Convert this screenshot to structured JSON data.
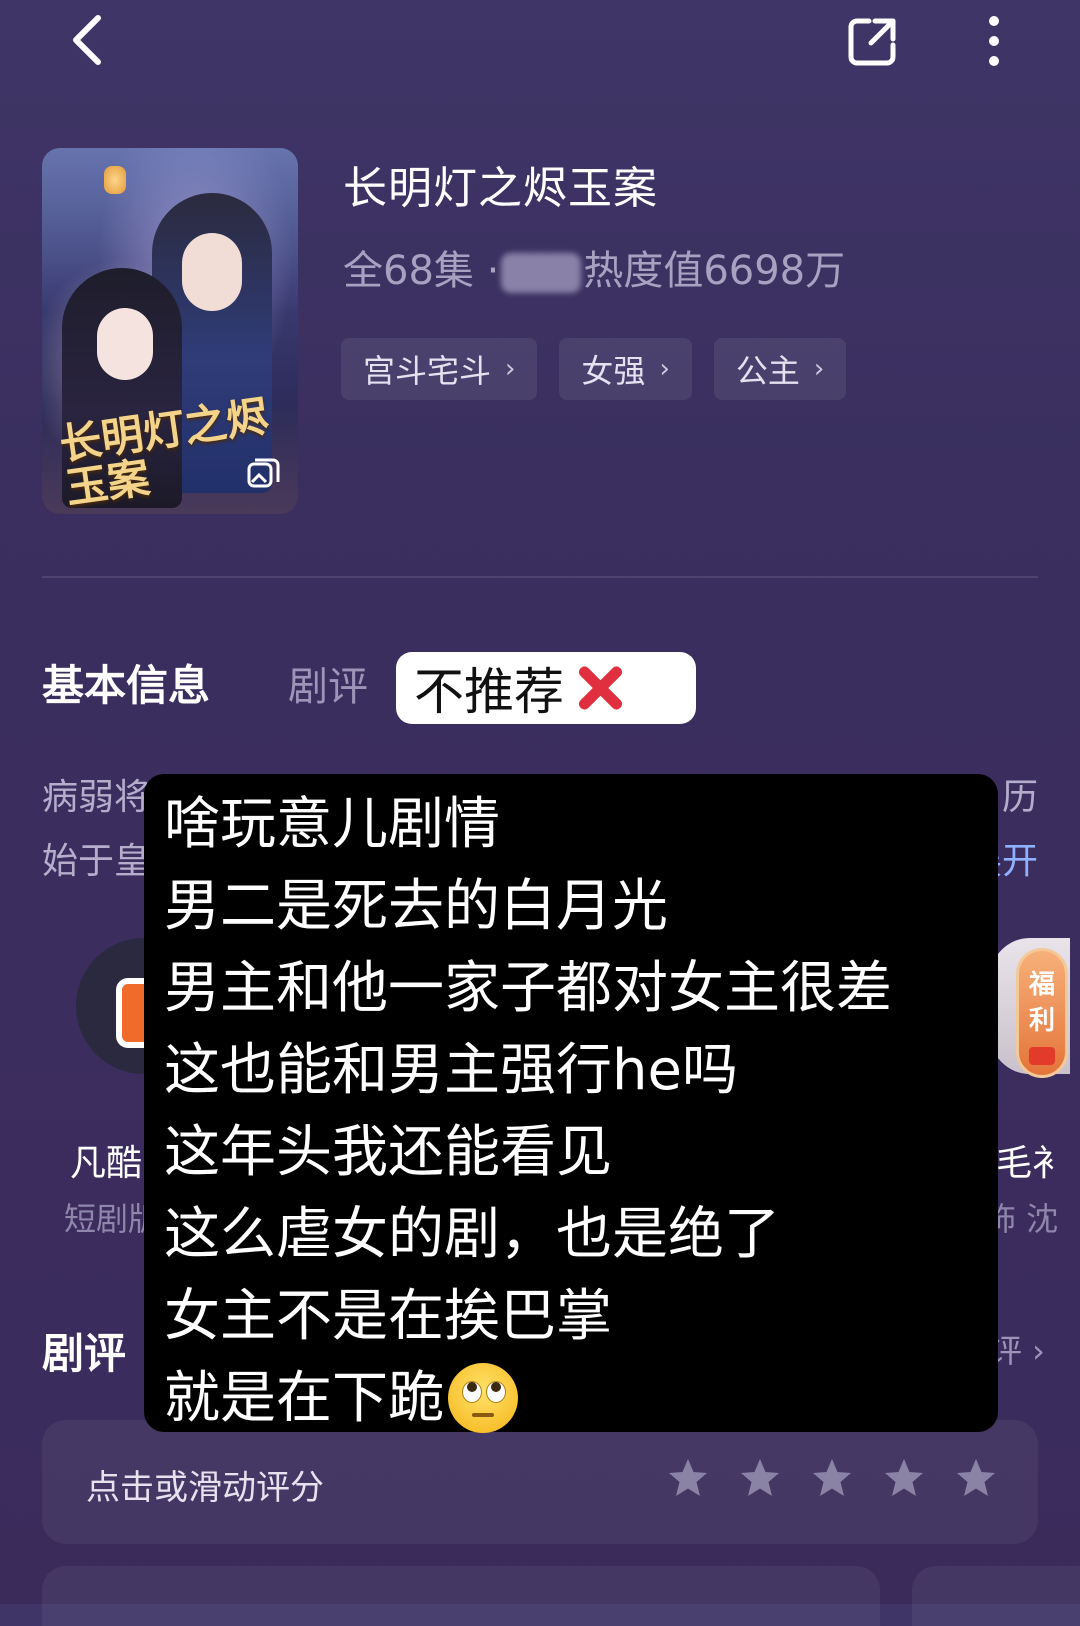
{
  "top_bar": {
    "back_icon": "chevron-left-icon",
    "share_icon": "share-icon",
    "more_icon": "more-vertical-icon"
  },
  "show": {
    "title": "长明灯之烬玉案",
    "poster_title": "长明灯之烬玉案",
    "episodes_text": "全68集 ·",
    "heat_text": "热度值6698万",
    "tags": [
      {
        "label": "宫斗宅斗"
      },
      {
        "label": "女强"
      },
      {
        "label": "公主"
      }
    ]
  },
  "tabs": {
    "basic_info": "基本信息",
    "reviews": "剧评"
  },
  "sticker": {
    "text": "不推荐"
  },
  "description": {
    "line1_start": "病弱将",
    "line1_end": "历",
    "line2_start": "始于皇",
    "expand": "展开"
  },
  "cast": {
    "left": {
      "name": "凡酷",
      "role": "短剧版"
    },
    "right": {
      "name": "毛衤",
      "role": "饰 沈",
      "badge_line1": "福",
      "badge_line2": "利"
    }
  },
  "reviews_section": {
    "heading": "剧评",
    "more": "评 ›"
  },
  "overlay": {
    "lines": [
      "啥玩意儿剧情",
      "男二是死去的白月光",
      "男主和他一家子都对女主很差",
      "这也能和男主强行he吗",
      "这年头我还能看见",
      "这么虐女的剧，也是绝了",
      "女主不是在挨巴掌",
      "就是在下跪"
    ]
  },
  "rating": {
    "prompt": "点击或滑动评分",
    "star_count": 5
  }
}
